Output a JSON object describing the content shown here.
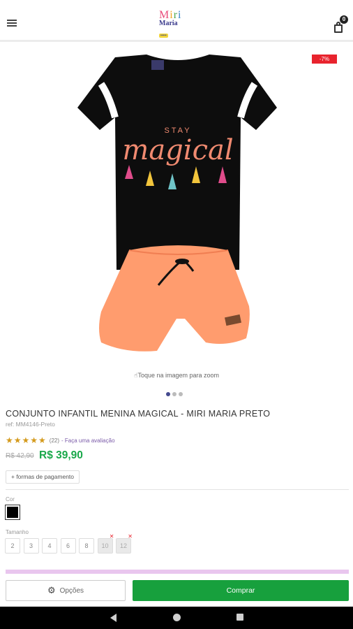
{
  "header": {
    "logo_line1": "Miri",
    "logo_line2": "Maria",
    "logo_line3": "•••••",
    "cart_count": "0"
  },
  "product": {
    "discount_badge": "-7%",
    "tshirt_text_small": "STAY",
    "tshirt_text_large": "magical",
    "zoom_hint": "Toque na imagem para zoom",
    "title": "CONJUNTO INFANTIL MENINA MAGICAL - MIRI MARIA PRETO",
    "ref": "ref: MM4146-Preto",
    "rating_stars": 5,
    "rating_count": "(22)",
    "rating_link": "- Faça uma avaliação",
    "old_price": "R$ 42,90",
    "price": "R$ 39,90",
    "payment_button": "+ formas de pagamento"
  },
  "carousel": {
    "count": 3,
    "active": 0
  },
  "color": {
    "label": "Cor",
    "selected": "#000000"
  },
  "sizes": {
    "label": "Tamanho",
    "options": [
      {
        "label": "2",
        "available": true
      },
      {
        "label": "3",
        "available": true
      },
      {
        "label": "4",
        "available": true
      },
      {
        "label": "6",
        "available": true
      },
      {
        "label": "8",
        "available": true
      },
      {
        "label": "10",
        "available": false
      },
      {
        "label": "12",
        "available": false
      }
    ]
  },
  "footer": {
    "options_label": "Opções",
    "buy_label": "Comprar"
  },
  "colors": {
    "price_green": "#19a84a",
    "buy_green": "#17a03d",
    "discount_red": "#e8232d",
    "accent_purple": "#444a8f"
  }
}
